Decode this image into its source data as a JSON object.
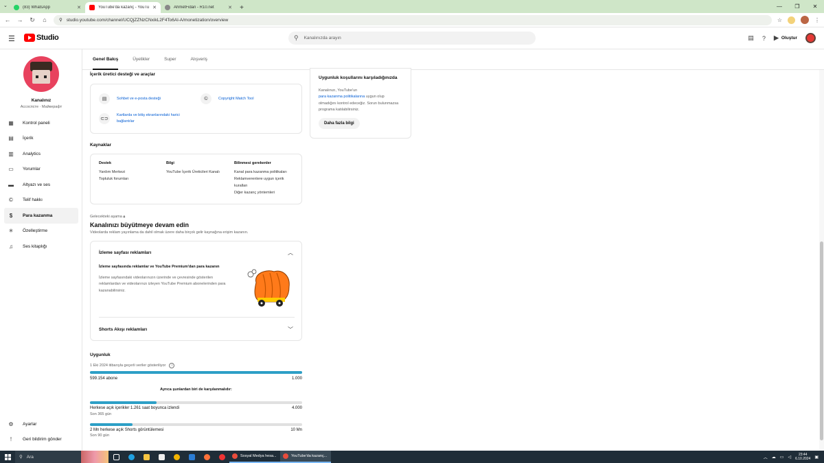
{
  "browser": {
    "tabs": [
      {
        "title": "(83) WhatsApp",
        "color": "#25d366",
        "active": false
      },
      {
        "title": "YouTube'da kazanç - YouTube",
        "color": "#ff0000",
        "active": true
      },
      {
        "title": "AhmetFidan - R10.net",
        "color": "#555555",
        "active": false
      }
    ],
    "url": "studio.youtube.com/channel/UCQjZZNzCNxikL2F4To6Al-A/monetization/overview"
  },
  "header": {
    "logo_text": "Studio",
    "search_placeholder": "Kanalınızda arayın",
    "create_label": "Oluştur"
  },
  "channel": {
    "name": "Kanalınız",
    "subtitle": "Ассоспсте · Майкерафт"
  },
  "sidebar": {
    "items": [
      {
        "label": "Kontrol paneli",
        "icon": "dashboard-icon",
        "glyph": "▦",
        "active": false
      },
      {
        "label": "İçerik",
        "icon": "content-icon",
        "glyph": "▤",
        "active": false
      },
      {
        "label": "Analytics",
        "icon": "analytics-icon",
        "glyph": "▥",
        "active": false
      },
      {
        "label": "Yorumlar",
        "icon": "comments-icon",
        "glyph": "▭",
        "active": false
      },
      {
        "label": "Altyazı ve ses",
        "icon": "subtitles-icon",
        "glyph": "▬",
        "active": false
      },
      {
        "label": "Telif hakkı",
        "icon": "copyright-icon",
        "glyph": "©",
        "active": false
      },
      {
        "label": "Para kazanma",
        "icon": "monetization-icon",
        "glyph": "$",
        "active": true
      },
      {
        "label": "Özelleştirme",
        "icon": "customization-icon",
        "glyph": "✳",
        "active": false
      },
      {
        "label": "Ses kitaplığı",
        "icon": "audio-library-icon",
        "glyph": "♫",
        "active": false
      }
    ],
    "bottom": [
      {
        "label": "Ayarlar",
        "icon": "settings-icon",
        "glyph": "⚙"
      },
      {
        "label": "Geri bildirim gönder",
        "icon": "feedback-icon",
        "glyph": "!"
      }
    ]
  },
  "tabs": [
    "Genel Bakış",
    "Üyelikler",
    "Super",
    "Alışveriş"
  ],
  "creator_support": {
    "title": "İçerik üretici desteği ve araçlar",
    "chat_label": "Sohbet ve e-posta desteği",
    "copyright_tool": "Copyright Match Tool",
    "links_label_1": "Kartlarda ve bitiş ekranlarındaki harici",
    "links_label_2": "bağlantılar"
  },
  "resources": {
    "title": "Kaynaklar",
    "support_head": "Destek",
    "support_items": [
      "Yardım Merkezi",
      "Topluluk forumları"
    ],
    "info_head": "Bilgi",
    "info_items": [
      "YouTube İçerik Üreticileri Kanalı"
    ],
    "know_head": "Bilinmesi gerekenler",
    "know_items": [
      "Kanal para kazanma politikaları",
      "Reklamverenlere uygun içerik",
      "kuralları",
      "Diğer kazanç yöntemleri"
    ]
  },
  "growth": {
    "future_label": "Gelecekteki aşama",
    "title": "Kanalınızı büyütmeye devam edin",
    "subtitle": "Videolarda reklam yayınlama da dahil olmak üzere daha birçok gelir kaynağına erişim kazanın.",
    "watch_ads_title": "İzleme sayfası reklamları",
    "watch_ads_heading": "İzleme sayfasında reklamlar ve YouTube Premium'dan para kazanın",
    "watch_ads_body_1": "İzleme sayfasındaki videolarınızın üzerinde ve çevresinde gösterilen",
    "watch_ads_body_2": "reklamlardan ve videolarınızı izleyen YouTube Premium abonelerinden para",
    "watch_ads_body_3": "kazanabilirsiniz.",
    "shorts_ads_title": "Shorts Akışı reklamları"
  },
  "eligibility": {
    "title": "Uygunluk",
    "date_note": "1 Eki 2024 itibarıyla geçerli veriler gösteriliyor",
    "subs_label": "599.154 abone",
    "subs_target": "1.000",
    "subs_progress": 1.0,
    "also_meet": "Ayrıca şunlardan biri de karşılanmalıdır:",
    "hours_label": "Herkese açık içerikler 1.261 saat boyunca izlendi",
    "hours_target": "4.000",
    "hours_sub": "Son 365 gün",
    "hours_progress": 0.3152,
    "shorts_label": "2 Mn herkese açık Shorts görüntülemesi",
    "shorts_target": "10 Mn",
    "shorts_sub": "Son 90 gün",
    "shorts_progress": 0.2
  },
  "requirements_card": {
    "title": "Uygunluk koşullarını karşıladığınızda",
    "body_1": "Kanalınızı, YouTube'un",
    "body_link": "para kazanma politikalarına",
    "body_2": "uygun olup olmadığını kontrol edeceğiz. Sorun bulunmazsa programa katılabilirsiniz.",
    "button": "Daha fazla bilgi"
  },
  "taskbar": {
    "search_label": "Ara",
    "windows": [
      {
        "title": "Sosyal Medya hesa...",
        "color": "#e74c3c",
        "active": false
      },
      {
        "title": "YouTube'da kazanç...",
        "color": "#e74c3c",
        "active": true
      }
    ],
    "time": "23:44",
    "date": "6.10.2024"
  },
  "colors": {
    "accent": "#2d9fc6",
    "brand": "#ff0000",
    "link": "#065fd4"
  }
}
